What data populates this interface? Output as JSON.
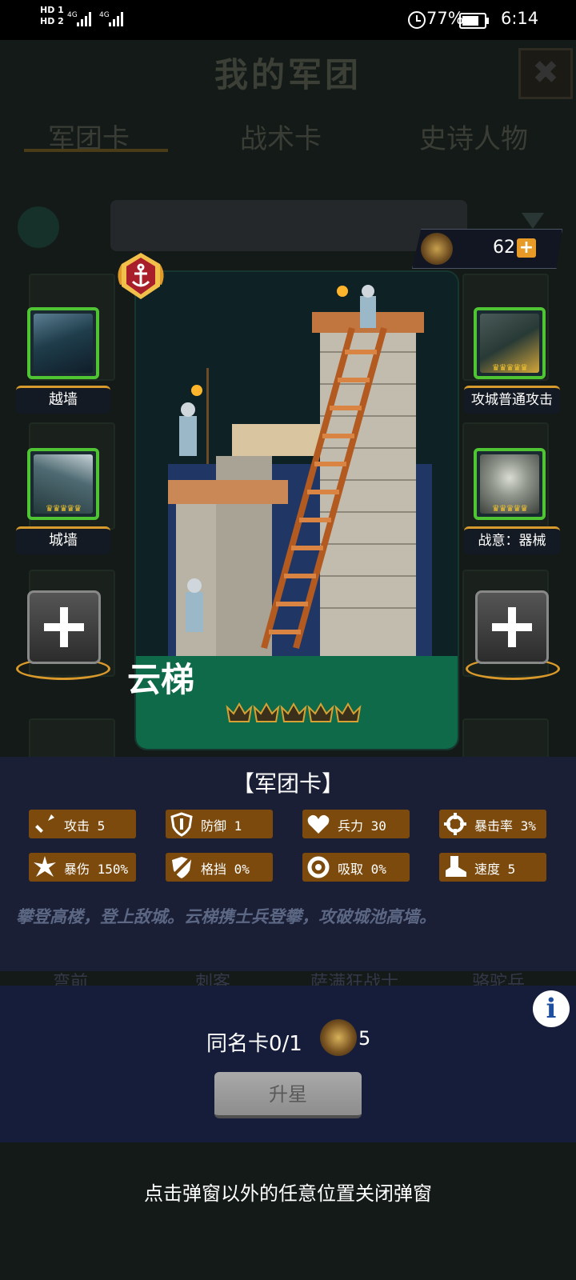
{
  "status_bar": {
    "hd1": "HD 1",
    "hd2": "HD 2",
    "net1": "4G",
    "net2": "4G",
    "battery_pct": "77%",
    "battery_level": 0.77,
    "time": "6:14"
  },
  "background": {
    "title": "我的军团",
    "tabs": [
      "军团卡",
      "战术卡",
      "史诗人物"
    ],
    "row_labels": [
      "弯前",
      "刺客",
      "萨满狂战士",
      "骆驼兵"
    ]
  },
  "currency": {
    "value": "62",
    "plus": "+"
  },
  "skills": {
    "left_top": "越墙",
    "left_mid": "城墙",
    "right_top": "攻城普通攻击",
    "right_mid": "战意：器械"
  },
  "card": {
    "name": "云梯",
    "stars": 5
  },
  "info": {
    "title": "【军团卡】",
    "stats": [
      {
        "icon": "sword-icon",
        "label": "攻击 5"
      },
      {
        "icon": "shield-icon",
        "label": "防御 1"
      },
      {
        "icon": "heart-icon",
        "label": "兵力 30"
      },
      {
        "icon": "crosshair-icon",
        "label": "暴击率 3%"
      },
      {
        "icon": "burst-icon",
        "label": "暴伤 150%"
      },
      {
        "icon": "block-icon",
        "label": "格挡 0%"
      },
      {
        "icon": "drain-icon",
        "label": "吸取 0%"
      },
      {
        "icon": "boot-icon",
        "label": "速度 5"
      }
    ],
    "description": "攀登高楼，登上敌城。云梯携士兵登攀，攻破城池高墙。"
  },
  "bottom": {
    "duplicate_label": "同名卡0/1",
    "duplicate_cost": "5",
    "upgrade_label": "升星",
    "info_icon_label": "i"
  },
  "close_hint": "点击弹窗以外的任意位置关闭弹窗",
  "colors": {
    "accent_gold": "#d99a2b",
    "card_green": "#0f6a49",
    "skill_border": "#50c534",
    "stat_bg": "#7c4a0c",
    "panel_bg": "#1a1f36"
  }
}
